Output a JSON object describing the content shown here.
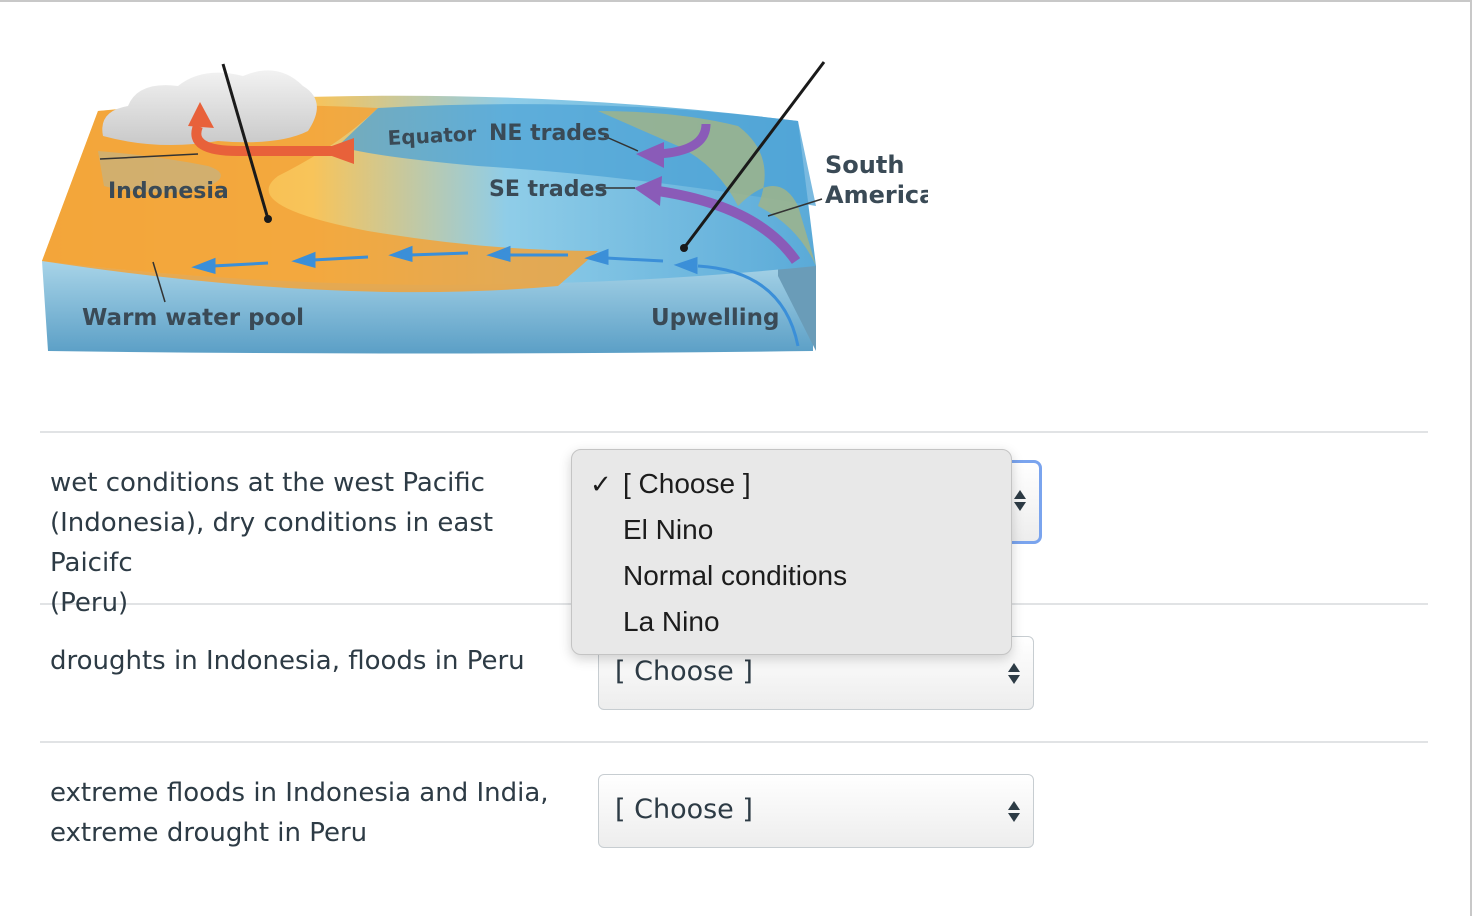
{
  "figure": {
    "labels": {
      "indonesia": "Indonesia",
      "equator": "Equator",
      "ne_trades": "NE trades",
      "se_trades": "SE trades",
      "south": "South",
      "america": "America",
      "warm_pool": "Warm water pool",
      "upwelling": "Upwelling"
    }
  },
  "questions": [
    {
      "prompt_lines": [
        "wet conditions at the west Pacific",
        "(Indonesia), dry conditions in east Paicifc",
        "(Peru)"
      ],
      "selected": "[ Choose ]"
    },
    {
      "prompt_lines": [
        "droughts in Indonesia, floods in Peru"
      ],
      "selected": "[ Choose ]"
    },
    {
      "prompt_lines": [
        "extreme floods in Indonesia and India,",
        "extreme drought in Peru"
      ],
      "selected": "[ Choose ]"
    }
  ],
  "dropdown": {
    "check_glyph": "✓",
    "options": [
      "[ Choose ]",
      "El Nino",
      "Normal conditions",
      "La Nino"
    ],
    "checked_index": 0
  },
  "colors": {
    "focus_ring": "#7aa4ee",
    "warm_water": "#f2a33a",
    "cool_water": "#5aaad8",
    "arrow_red": "#e8613a",
    "arrow_purple": "#8a5bb8",
    "arrow_blue": "#3b8fd8"
  },
  "icons": {
    "select_arrows": "updown-arrows-icon",
    "checkmark": "checkmark-icon"
  }
}
